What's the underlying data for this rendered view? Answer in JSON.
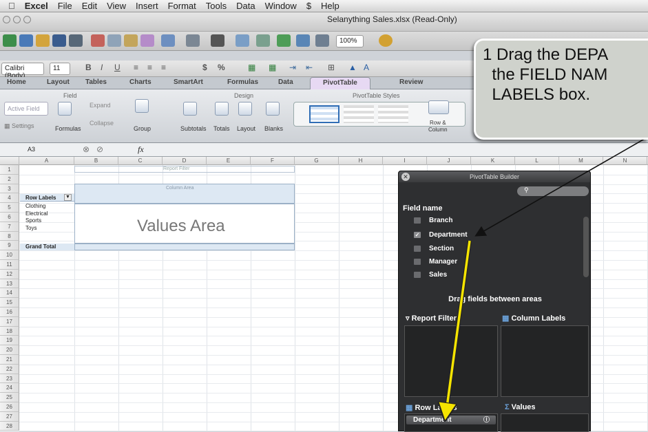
{
  "menubar": {
    "items": [
      "Excel",
      "File",
      "Edit",
      "View",
      "Insert",
      "Format",
      "Tools",
      "Data",
      "Window",
      "Help"
    ]
  },
  "window": {
    "title": "Selanything Sales.xlsx (Read-Only)"
  },
  "toolbar": {
    "zoom": "100%"
  },
  "formatbar": {
    "font": "Calibri (Body)",
    "size": "11",
    "bold": "B",
    "italic": "I",
    "underline": "U",
    "currency": "$",
    "percent": "%"
  },
  "ribbon": {
    "tabs": [
      "Home",
      "Layout",
      "Tables",
      "Charts",
      "SmartArt",
      "Formulas",
      "Data",
      "PivotTable",
      "Review"
    ],
    "groups": {
      "field": "Field",
      "design": "Design",
      "styles": "PivotTable Styles"
    },
    "buttons": {
      "active_field": "Active Field",
      "settings": "Settings",
      "formulas": "Formulas",
      "expand": "Expand",
      "collapse": "Collapse",
      "group": "Group",
      "subtotals": "Subtotals",
      "totals": "Totals",
      "layout": "Layout",
      "blanks": "Blanks",
      "row_col_1": "Row &",
      "row_col_2": "Column"
    }
  },
  "formula_bar": {
    "cell_ref": "A3",
    "fx": "fx"
  },
  "sheet": {
    "columns": [
      "A",
      "B",
      "C",
      "D",
      "E",
      "F",
      "G",
      "H",
      "I",
      "J",
      "K",
      "L",
      "M",
      "N"
    ],
    "rows": [
      "1",
      "2",
      "3",
      "4",
      "5",
      "6",
      "7",
      "8",
      "9",
      "10",
      "11",
      "12",
      "13",
      "14",
      "15",
      "16",
      "17",
      "18",
      "19",
      "20",
      "21",
      "22",
      "23",
      "24",
      "25",
      "26",
      "27",
      "28"
    ],
    "report_filter": "Report Filter",
    "column_area": "Column Area",
    "values_area": "Values Area",
    "row_labels_header": "Row Labels",
    "row_items": [
      "Clothing",
      "Electrical",
      "Sports",
      "Toys"
    ],
    "grand_total": "Grand Total"
  },
  "builder": {
    "title": "PivotTable Builder",
    "field_name_label": "Field name",
    "fields": [
      "Branch",
      "Department",
      "Section",
      "Manager",
      "Sales"
    ],
    "checked_field": "Department",
    "drag_hint": "Drag fields between areas",
    "report_filter": "Report Filter",
    "column_labels": "Column Labels",
    "row_labels": "Row Labels",
    "values": "Values",
    "row_labels_item": "Department"
  },
  "callout": {
    "text": "1 Drag the DEPA\n  the FIELD NAM\n  LABELS box."
  },
  "colors": {
    "arrow": "#f5e400",
    "builder_bg": "#2e2f31",
    "pivot_tab": "#e7d9f3"
  }
}
